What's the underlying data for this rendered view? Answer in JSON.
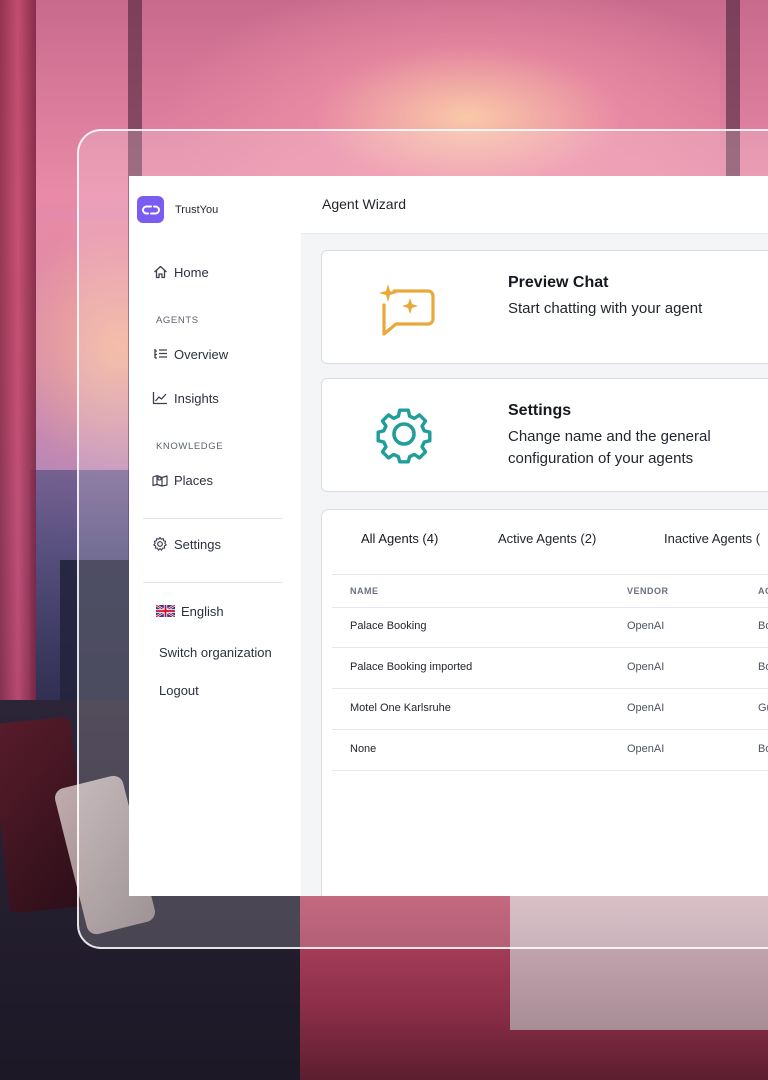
{
  "brand": {
    "name": "TrustYou"
  },
  "sidebar": {
    "home": "Home",
    "agents_section": "AGENTS",
    "overview": "Overview",
    "insights": "Insights",
    "knowledge_section": "KNOWLEDGE",
    "places": "Places",
    "settings": "Settings",
    "language": "English",
    "switch_org": "Switch organization",
    "logout": "Logout"
  },
  "header": {
    "title": "Agent Wizard"
  },
  "cards": {
    "preview": {
      "title": "Preview Chat",
      "desc": "Start chatting with your agent"
    },
    "settings": {
      "title": "Settings",
      "desc": "Change name and the general configuration of your agents"
    }
  },
  "tabs": [
    {
      "label": "All Agents (4)"
    },
    {
      "label": "Active Agents (2)"
    },
    {
      "label": "Inactive Agents ("
    }
  ],
  "table": {
    "columns": [
      "NAME",
      "VENDOR",
      "AC"
    ],
    "rows": [
      {
        "name": "Palace Booking",
        "vendor": "OpenAI",
        "extra": "Bo"
      },
      {
        "name": "Palace Booking imported",
        "vendor": "OpenAI",
        "extra": "Bo"
      },
      {
        "name": "Motel One Karlsruhe",
        "vendor": "OpenAI",
        "extra": "Gu"
      },
      {
        "name": "None",
        "vendor": "OpenAI",
        "extra": "Bo"
      }
    ]
  },
  "colors": {
    "brand": "#7b5cf0",
    "preview_icon": "#e9a93a",
    "settings_icon": "#1f9e9a"
  }
}
